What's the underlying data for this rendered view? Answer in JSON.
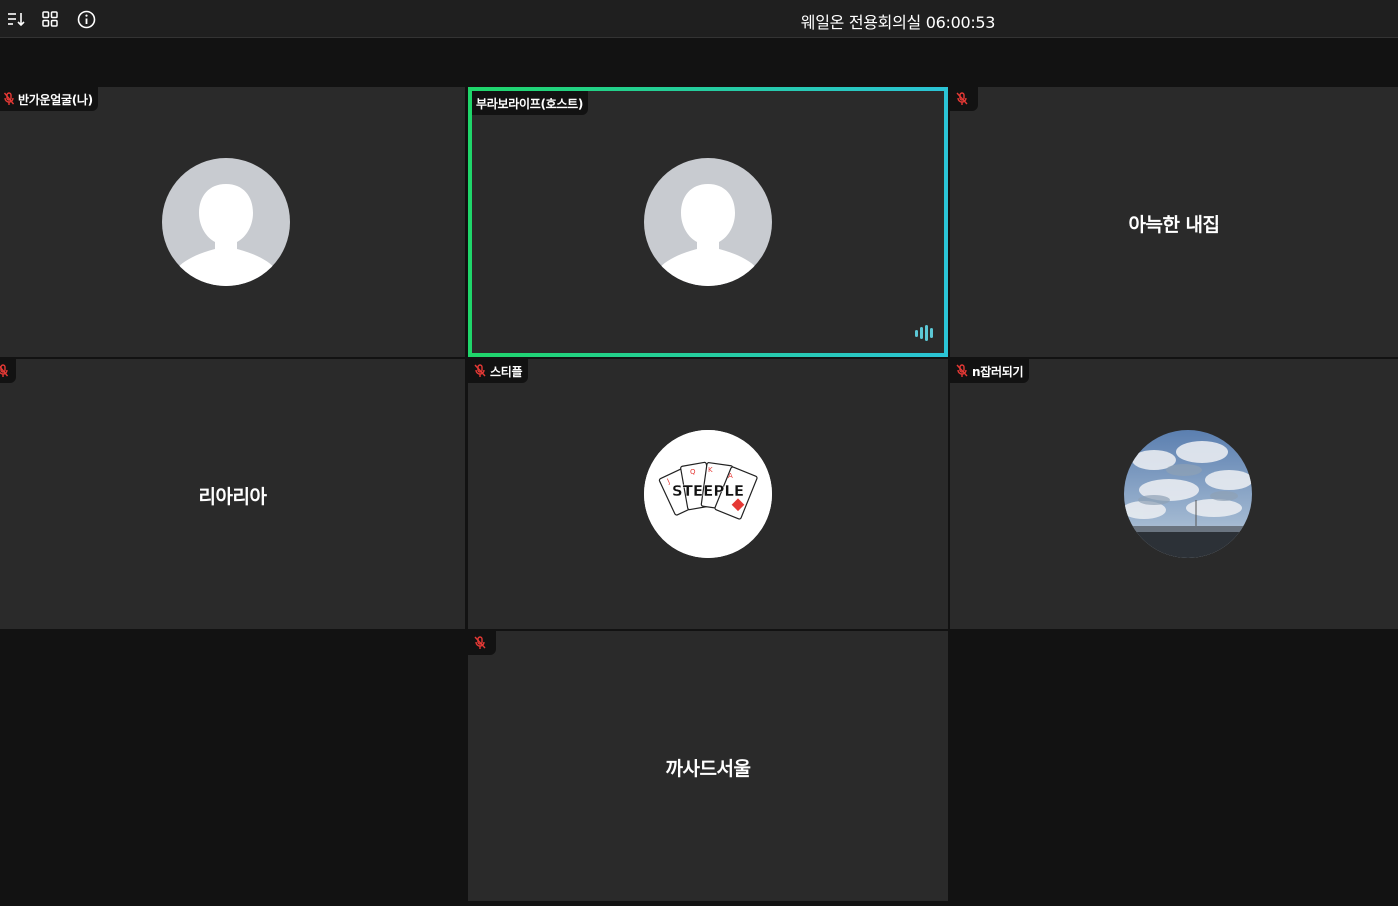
{
  "header": {
    "title": "웨일온 전용회의실 06:00:53",
    "icons": [
      "sort-icon",
      "grid-layout-icon",
      "info-icon"
    ]
  },
  "colors": {
    "active_border_start": "#1fd66a",
    "active_border_end": "#2bc4d6",
    "mic_off": "#e53935",
    "speaking": "#5cc8d6"
  },
  "participants": [
    {
      "name": "반가운얼굴(나)",
      "muted": true,
      "display": "avatar-placeholder"
    },
    {
      "name": "부라보라이프(호스트)",
      "muted": false,
      "display": "avatar-placeholder",
      "speaking": true
    },
    {
      "name": "",
      "muted": true,
      "display": "text",
      "label": "아늑한 내집"
    },
    {
      "name": "",
      "muted": true,
      "display": "text",
      "label": "리아리아"
    },
    {
      "name": "스티플",
      "muted": true,
      "display": "avatar-image",
      "image_text": "STEEPLE"
    },
    {
      "name": "n잡러되기",
      "muted": true,
      "display": "avatar-image"
    },
    {
      "name": "",
      "muted": true,
      "display": "text",
      "label": "까사드서울"
    }
  ]
}
